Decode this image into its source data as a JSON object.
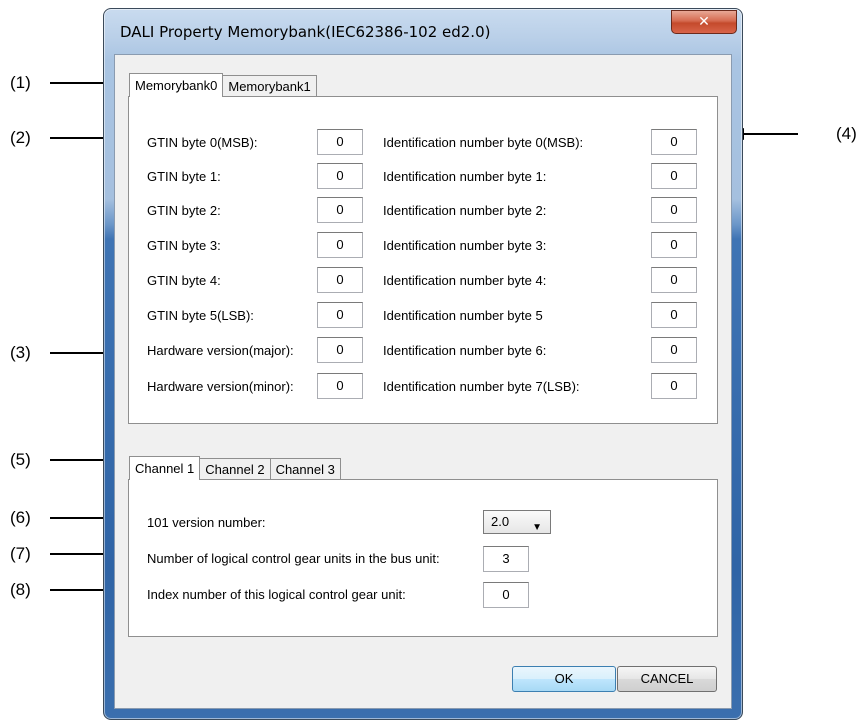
{
  "window": {
    "title": "DALI Property Memorybank(IEC62386-102 ed2.0)",
    "close_symbol": "✕"
  },
  "memorybank_tabs": [
    "Memorybank0",
    "Memorybank1"
  ],
  "gtin": {
    "labels": [
      "GTIN byte 0(MSB):",
      "GTIN byte 1:",
      "GTIN byte 2:",
      "GTIN byte 3:",
      "GTIN byte 4:",
      "GTIN byte 5(LSB):",
      "Hardware version(major):",
      "Hardware version(minor):"
    ],
    "values": [
      "0",
      "0",
      "0",
      "0",
      "0",
      "0",
      "0",
      "0"
    ]
  },
  "identification": {
    "labels": [
      "Identification number byte 0(MSB):",
      "Identification number byte 1:",
      "Identification number byte 2:",
      "Identification number byte 3:",
      "Identification number byte 4:",
      "Identification number byte 5",
      "Identification number byte 6:",
      "Identification number byte 7(LSB):"
    ],
    "values": [
      "0",
      "0",
      "0",
      "0",
      "0",
      "0",
      "0",
      "0"
    ]
  },
  "channel_tabs": [
    "Channel 1",
    "Channel 2",
    "Channel 3"
  ],
  "channel": {
    "version_label": "101 version number:",
    "version_value": "2.0",
    "units_label": "Number of logical control gear units in the bus unit:",
    "units_value": "3",
    "index_label": "Index number of this logical control gear unit:",
    "index_value": "0"
  },
  "buttons": {
    "ok": "OK",
    "cancel": "CANCEL"
  },
  "callouts": [
    "(1)",
    "(2)",
    "(3)",
    "(4)",
    "(5)",
    "(6)",
    "(7)",
    "(8)"
  ],
  "colors": {
    "close_button": "#c44a2c",
    "window_frame": "#2f64a6",
    "default_button": "#3c7fb1"
  }
}
